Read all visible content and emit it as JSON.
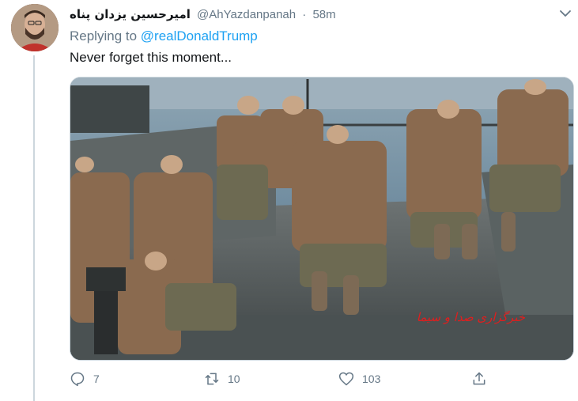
{
  "tweet": {
    "author_name": "امیرحسین یزدان پناه",
    "author_handle": "@AhYazdanpanah",
    "separator": "·",
    "time": "58m",
    "reply_prefix": "Replying to",
    "reply_mention": "@realDonaldTrump",
    "text": "Never forget this moment...",
    "media_alt": "photo",
    "media_watermark": "خبرگزاری صدا و سیما"
  },
  "actions": {
    "reply_count": "7",
    "retweet_count": "10",
    "like_count": "103"
  },
  "icons": {
    "reply": "reply-icon",
    "retweet": "retweet-icon",
    "like": "heart-icon",
    "share": "share-icon",
    "more": "chevron-down-icon"
  },
  "colors": {
    "link": "#1da1f2",
    "muted": "#657786",
    "text": "#14171a"
  }
}
